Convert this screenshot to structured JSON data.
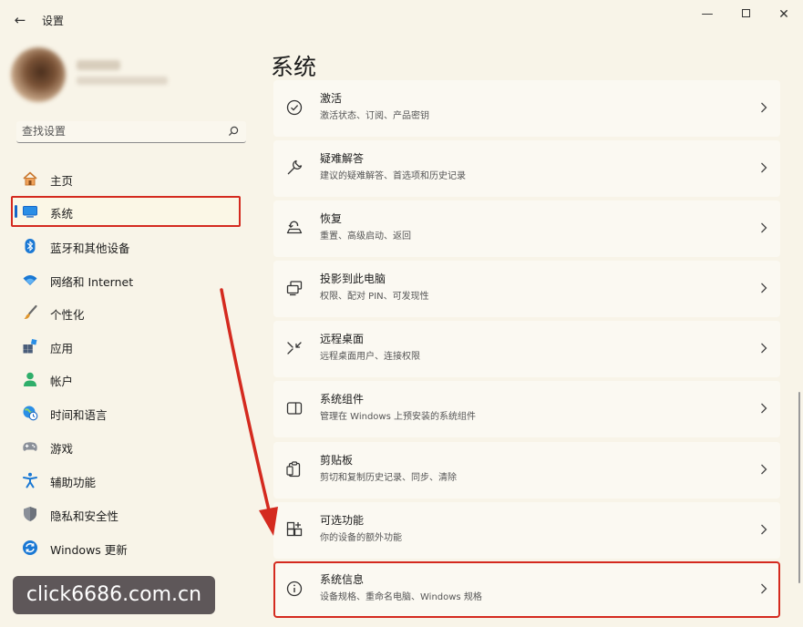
{
  "window": {
    "title": "设置",
    "back_icon": "back-arrow-icon",
    "minimize_icon": "minimize-icon",
    "maximize_icon": "maximize-icon",
    "close_icon": "close-icon"
  },
  "search": {
    "placeholder": "查找设置",
    "icon": "search-icon"
  },
  "sidebar": {
    "items": [
      {
        "label": "主页",
        "icon": "home-icon"
      },
      {
        "label": "系统",
        "icon": "system-display-icon",
        "selected": true
      },
      {
        "label": "蓝牙和其他设备",
        "icon": "bluetooth-icon"
      },
      {
        "label": "网络和 Internet",
        "icon": "wifi-icon"
      },
      {
        "label": "个性化",
        "icon": "brush-icon"
      },
      {
        "label": "应用",
        "icon": "apps-icon"
      },
      {
        "label": "帐户",
        "icon": "account-icon"
      },
      {
        "label": "时间和语言",
        "icon": "globe-clock-icon"
      },
      {
        "label": "游戏",
        "icon": "gamepad-icon"
      },
      {
        "label": "辅助功能",
        "icon": "accessibility-icon"
      },
      {
        "label": "隐私和安全性",
        "icon": "shield-icon"
      },
      {
        "label": "Windows 更新",
        "icon": "update-icon"
      }
    ]
  },
  "main": {
    "title": "系统",
    "cards": [
      {
        "title": "激活",
        "subtitle": "激活状态、订阅、产品密钥",
        "icon": "check-circle-icon"
      },
      {
        "title": "疑难解答",
        "subtitle": "建议的疑难解答、首选项和历史记录",
        "icon": "wrench-icon"
      },
      {
        "title": "恢复",
        "subtitle": "重置、高级启动、返回",
        "icon": "recovery-icon"
      },
      {
        "title": "投影到此电脑",
        "subtitle": "权限、配对 PIN、可发现性",
        "icon": "project-icon"
      },
      {
        "title": "远程桌面",
        "subtitle": "远程桌面用户、连接权限",
        "icon": "remote-desktop-icon"
      },
      {
        "title": "系统组件",
        "subtitle": "管理在 Windows 上预安装的系统组件",
        "icon": "components-icon"
      },
      {
        "title": "剪贴板",
        "subtitle": "剪切和复制历史记录、同步、清除",
        "icon": "clipboard-icon"
      },
      {
        "title": "可选功能",
        "subtitle": "你的设备的额外功能",
        "icon": "optional-features-icon"
      },
      {
        "title": "系统信息",
        "subtitle": "设备规格、重命名电脑、Windows 规格",
        "icon": "info-icon",
        "highlighted": true
      }
    ]
  },
  "watermark": {
    "text": "click6686.com.cn"
  },
  "colors": {
    "highlight": "#d42a1f",
    "accent": "#1667c8",
    "background": "#f8f4e8"
  }
}
